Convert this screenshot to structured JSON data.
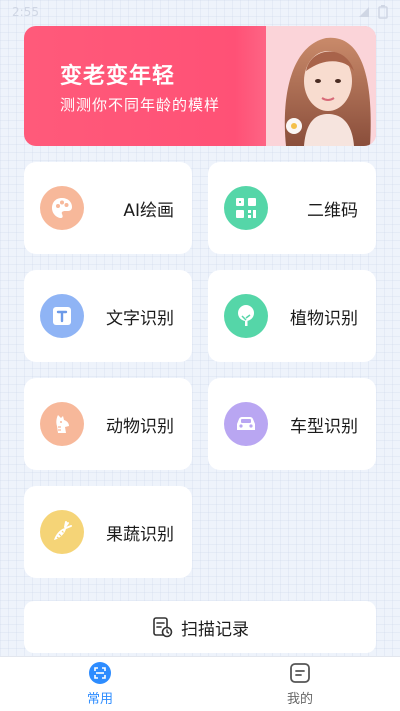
{
  "status_bar": {
    "time": "2:55"
  },
  "banner": {
    "title": "变老变年轻",
    "subtitle": "测测你不同年龄的模样"
  },
  "cards": [
    {
      "label": "AI绘画",
      "icon": "palette-icon",
      "color": "#f7b89a"
    },
    {
      "label": "二维码",
      "icon": "qr-code-icon",
      "color": "#55d6a8"
    },
    {
      "label": "文字识别",
      "icon": "text-icon",
      "color": "#8fb4f5"
    },
    {
      "label": "植物识别",
      "icon": "plant-icon",
      "color": "#55d6a8"
    },
    {
      "label": "动物识别",
      "icon": "animal-icon",
      "color": "#f7b89a"
    },
    {
      "label": "车型识别",
      "icon": "car-icon",
      "color": "#b9a6f2"
    },
    {
      "label": "果蔬识别",
      "icon": "carrot-icon",
      "color": "#f5d477"
    }
  ],
  "scan_record": {
    "label": "扫描记录",
    "icon": "scan-record-icon"
  },
  "tabs": [
    {
      "label": "常用",
      "icon": "scan-icon",
      "active": true
    },
    {
      "label": "我的",
      "icon": "profile-icon",
      "active": false
    }
  ],
  "colors": {
    "accent": "#2d8cff",
    "banner": "#ff5a7a"
  }
}
